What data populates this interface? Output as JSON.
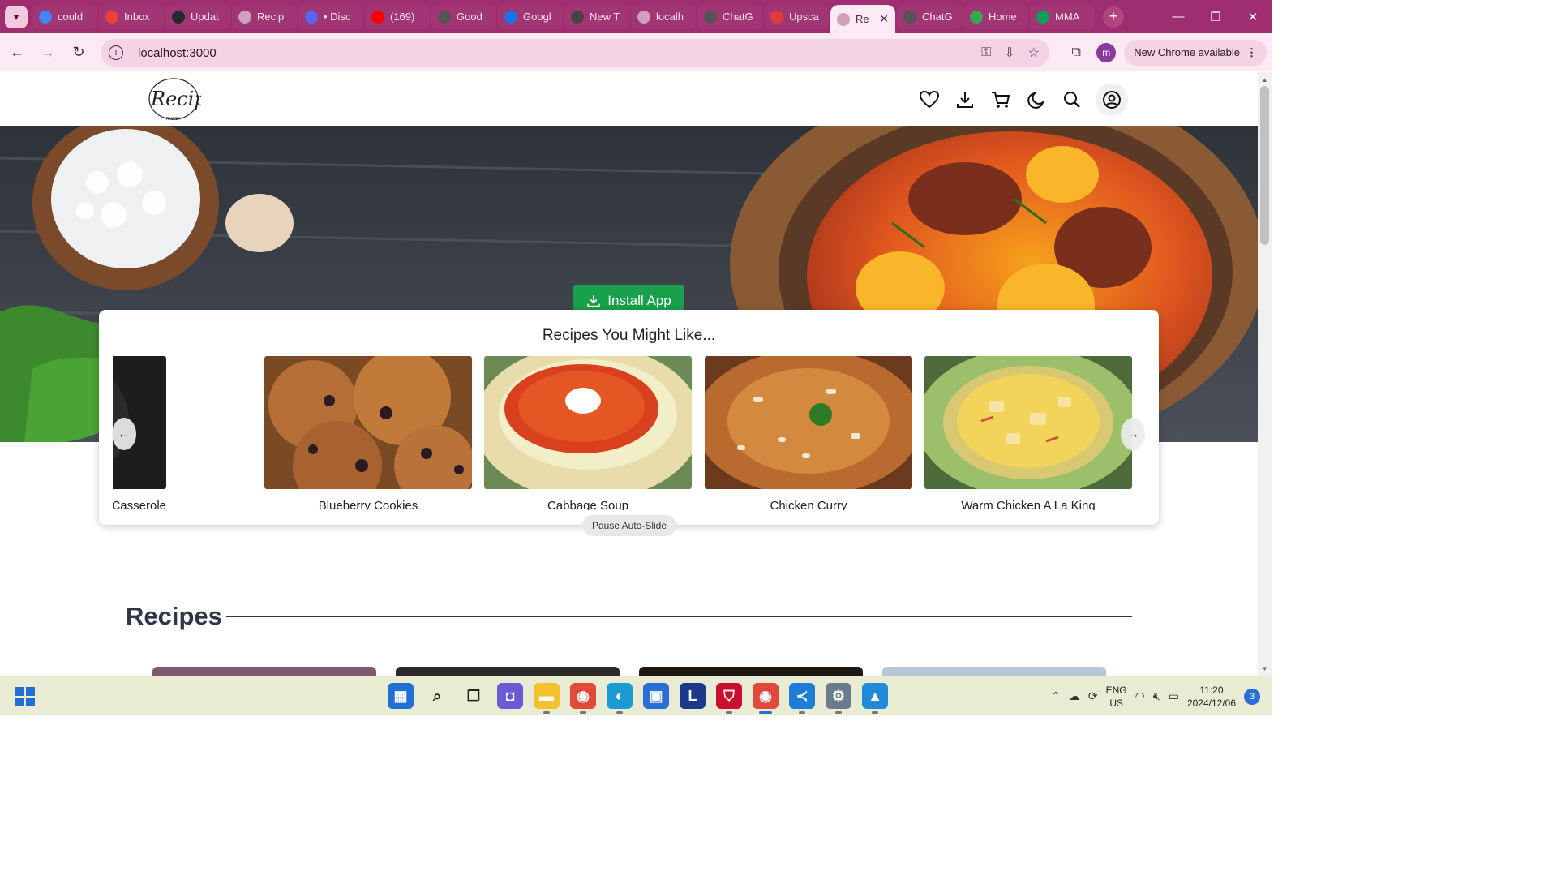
{
  "browser": {
    "tabs": [
      {
        "title": "could",
        "icon": "google-icon",
        "color": "#4285f4"
      },
      {
        "title": "Inbox",
        "icon": "gmail-icon",
        "color": "#ea4335"
      },
      {
        "title": "Updat",
        "icon": "github-icon",
        "color": "#24292e"
      },
      {
        "title": "Recip",
        "icon": "globe-icon",
        "color": "#cfa0bb"
      },
      {
        "title": "• Disc",
        "icon": "discord-icon",
        "color": "#5865f2"
      },
      {
        "title": "(169)",
        "icon": "youtube-icon",
        "color": "#ff0000"
      },
      {
        "title": "Good",
        "icon": "chatgpt-icon",
        "color": "#555"
      },
      {
        "title": "Googl",
        "icon": "google-calendar-icon",
        "color": "#1a73e8"
      },
      {
        "title": "New T",
        "icon": "chrome-icon",
        "color": "#444"
      },
      {
        "title": "localh",
        "icon": "globe-icon",
        "color": "#cfa0bb"
      },
      {
        "title": "ChatG",
        "icon": "chatgpt-icon",
        "color": "#555"
      },
      {
        "title": "Upsca",
        "icon": "p-icon",
        "color": "#e03b3b"
      },
      {
        "title": "Re",
        "icon": "globe-icon",
        "color": "#cfa0bb",
        "active": true
      },
      {
        "title": "ChatG",
        "icon": "chatgpt-icon",
        "color": "#555"
      },
      {
        "title": "Home",
        "icon": "drive-icon",
        "color": "#34a853"
      },
      {
        "title": "MMA",
        "icon": "sheets-plus-icon",
        "color": "#0f9d58"
      }
    ],
    "new_tab_label": "+",
    "url": "localhost:3000",
    "update_label": "New Chrome available",
    "profile_initial": "m"
  },
  "site": {
    "logo_text": "Recipe",
    "logo_sub": "RUSH",
    "header_icons": [
      "heart-icon",
      "download-icon",
      "cart-icon",
      "moon-icon",
      "search-icon",
      "user-circle-icon"
    ],
    "install_label": "Install App",
    "carousel": {
      "title": "Recipes You Might Like...",
      "items": [
        {
          "label": "eeseburger Casserole",
          "art": "casserole"
        },
        {
          "label": "Blueberry Cookies",
          "art": "cookies"
        },
        {
          "label": "Cabbage Soup",
          "art": "soup"
        },
        {
          "label": "Chicken Curry",
          "art": "curry"
        },
        {
          "label": "Warm Chicken A La King",
          "art": "alaking"
        }
      ],
      "prev_label": "←",
      "next_label": "→",
      "pause_label": "Pause Auto-Slide"
    },
    "section_title": "Recipes"
  },
  "taskbar": {
    "apps": [
      "windows-start-icon",
      "search-icon",
      "task-view-icon",
      "teams-icon",
      "file-explorer-icon",
      "chrome-icon",
      "edge-icon",
      "store-icon",
      "l-app-icon",
      "mcafee-icon",
      "chrome-profile-icon",
      "vscode-icon",
      "settings-icon",
      "photos-icon"
    ],
    "lang_top": "ENG",
    "lang_bottom": "US",
    "time": "11:20",
    "date": "2024/12/06",
    "notifications": "3"
  }
}
